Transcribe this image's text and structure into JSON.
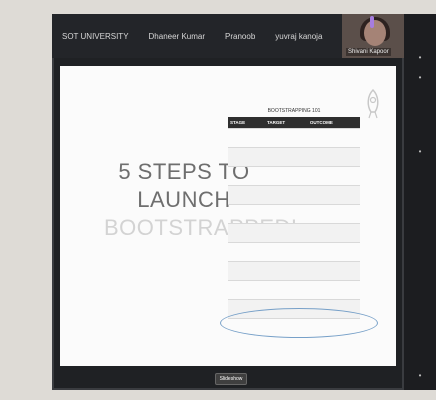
{
  "meeting": {
    "participants": [
      "SOT UNIVERSITY",
      "Dhaneer Kumar",
      "Pranoob",
      "yuvraj kanoja"
    ],
    "video_participant_name": "Shivani Kapoor"
  },
  "slide": {
    "title_line1": "5 STEPS TO",
    "title_line2": "LAUNCH",
    "title_line3": "BOOTSTRAPPED!",
    "table_title": "BOOTSTRAPPING 101",
    "headers": [
      "STAGE",
      "TARGET",
      "OUTCOME"
    ],
    "rows": [
      [
        "",
        "",
        ""
      ],
      [
        "",
        "",
        ""
      ],
      [
        "",
        "",
        ""
      ],
      [
        "",
        "",
        ""
      ],
      [
        "",
        "",
        ""
      ],
      [
        "",
        "",
        ""
      ],
      [
        "",
        "",
        ""
      ],
      [
        "",
        "",
        ""
      ],
      [
        "",
        "",
        ""
      ],
      [
        "",
        "",
        ""
      ],
      [
        "",
        "",
        ""
      ]
    ],
    "side_note": "",
    "slideshow_label": "Slideshow"
  },
  "colors": {
    "slide_bg": "#fbfbfb",
    "table_header": "#2f2f2f",
    "highlight_circle": "#77a0c8"
  }
}
